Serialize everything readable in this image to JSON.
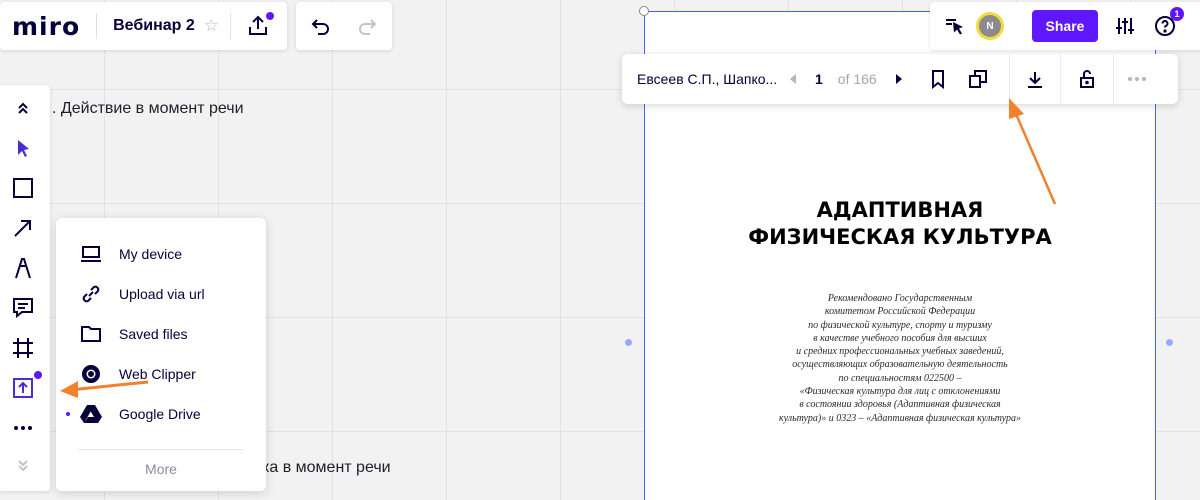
{
  "header": {
    "logo": "miro",
    "board_title": "Вебинар 2"
  },
  "topbar": {
    "avatar_initial": "N",
    "share_label": "Share",
    "notification_count": "1"
  },
  "board": {
    "text1": ". Действие в момент речи",
    "text2": "ка в момент речи"
  },
  "upload_menu": {
    "items": [
      {
        "label": "My device",
        "icon": "laptop-icon"
      },
      {
        "label": "Upload via url",
        "icon": "link-icon"
      },
      {
        "label": "Saved files",
        "icon": "folder-icon"
      },
      {
        "label": "Web Clipper",
        "icon": "chrome-icon"
      },
      {
        "label": "Google Drive",
        "icon": "google-drive-icon"
      }
    ],
    "more_label": "More"
  },
  "pdf_toolbar": {
    "doc_name": "Евсеев С.П., Шапко...",
    "current_page": "1",
    "total_pages": "of 166"
  },
  "document": {
    "title_line1": "АДАПТИВНАЯ",
    "title_line2": "ФИЗИЧЕСКАЯ КУЛЬТУРА",
    "body_lines": [
      "Рекомендовано Государственным",
      "комитетом Российской Федерации",
      "по физической культуре, спорту и туризму",
      "в качестве учебного пособия для высших",
      "и средних профессиональных учебных заведений,",
      "осуществляющих образовательную деятельность",
      "по специальностям 022500 –",
      "«Физическая культура для лиц с отклонениями",
      "в состоянии здоровья (Адаптивная физическая",
      "культура)» и 0323 – «Адаптивная физическая культура»"
    ]
  },
  "colors": {
    "accent": "#5f17ff",
    "annotation_arrow": "#f0812e",
    "selection": "#4262ff"
  }
}
